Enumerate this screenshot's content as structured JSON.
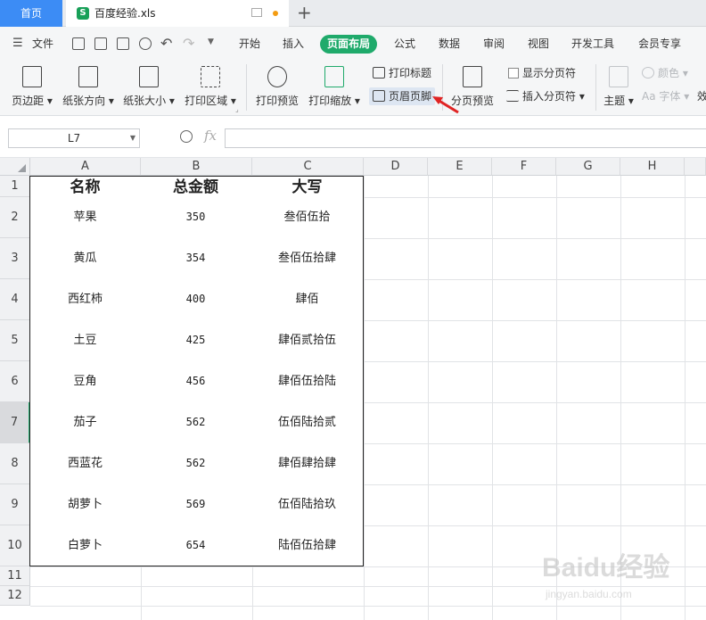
{
  "tabs": {
    "home": "首页",
    "file": "百度经验.xls",
    "new_tab": "+"
  },
  "menu": {
    "file_label": "文件",
    "items": [
      "开始",
      "插入",
      "页面布局",
      "公式",
      "数据",
      "审阅",
      "视图",
      "开发工具",
      "会员专享"
    ],
    "active": "页面布局"
  },
  "ribbon": {
    "margins": "页边距",
    "orientation": "纸张方向",
    "size": "纸张大小",
    "print_area": "打印区域",
    "print_preview": "打印预览",
    "print_scale": "打印缩放",
    "print_titles": "打印标题",
    "header_footer": "页眉页脚",
    "page_break_preview": "分页预览",
    "show_page_breaks": "显示分页符",
    "insert_page_break": "插入分页符",
    "theme": "主题",
    "colors": "颜色",
    "fonts": "Aa 字体",
    "effects": "效"
  },
  "formula_bar": {
    "cell_ref": "L7",
    "fx": "fx",
    "formula": ""
  },
  "grid": {
    "columns": [
      "A",
      "B",
      "C",
      "D",
      "E",
      "F",
      "G",
      "H"
    ],
    "rows": [
      "1",
      "2",
      "3",
      "4",
      "5",
      "6",
      "7",
      "8",
      "9",
      "10",
      "11",
      "12"
    ],
    "selected_row": "7",
    "header": [
      "名称",
      "总金额",
      "大写"
    ],
    "data": [
      [
        "苹果",
        "350",
        "叁佰伍拾"
      ],
      [
        "黄瓜",
        "354",
        "叁佰伍拾肆"
      ],
      [
        "西红柿",
        "400",
        "肆佰"
      ],
      [
        "土豆",
        "425",
        "肆佰贰拾伍"
      ],
      [
        "豆角",
        "456",
        "肆佰伍拾陆"
      ],
      [
        "茄子",
        "562",
        "伍佰陆拾贰"
      ],
      [
        "西蓝花",
        "562",
        "肆佰肆拾肆"
      ],
      [
        "胡萝卜",
        "569",
        "伍佰陆拾玖"
      ],
      [
        "白萝卜",
        "654",
        "陆佰伍拾肆"
      ]
    ]
  },
  "colors": {
    "accent_green": "#1faa6b",
    "home_tab_blue": "#3c8cf5",
    "arrow_red": "#e02424"
  },
  "watermark": {
    "brand": "Baidu经验",
    "url": "jingyan.baidu.com"
  }
}
